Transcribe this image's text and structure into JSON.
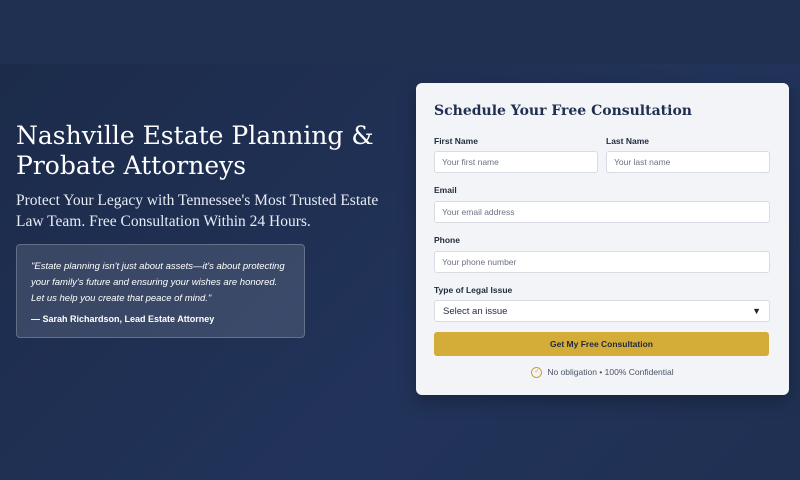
{
  "hero": {
    "title": "Nashville Estate Planning & Probate Attorneys",
    "subtitle": "Protect Your Legacy with Tennessee's Most Trusted Estate Law Team. Free Consultation Within 24 Hours.",
    "quote": "\"Estate planning isn't just about assets—it's about protecting your family's future and ensuring your wishes are honored. Let us help you create that peace of mind.\"",
    "quote_author": "— Sarah Richardson, Lead Estate Attorney"
  },
  "form": {
    "title": "Schedule Your Free Consultation",
    "first_name_label": "First Name",
    "first_name_placeholder": "Your first name",
    "last_name_label": "Last Name",
    "last_name_placeholder": "Your last name",
    "email_label": "Email",
    "email_placeholder": "Your email address",
    "phone_label": "Phone",
    "phone_placeholder": "Your phone number",
    "issue_label": "Type of Legal Issue",
    "issue_selected": "Select an issue",
    "submit_label": "Get My Free Consultation",
    "assurance": "No obligation • 100% Confidential",
    "check_icon": "check-circle-icon"
  },
  "colors": {
    "background": "#1f3051",
    "accent_gold": "#d4ad38",
    "card": "#f3f4f8"
  }
}
